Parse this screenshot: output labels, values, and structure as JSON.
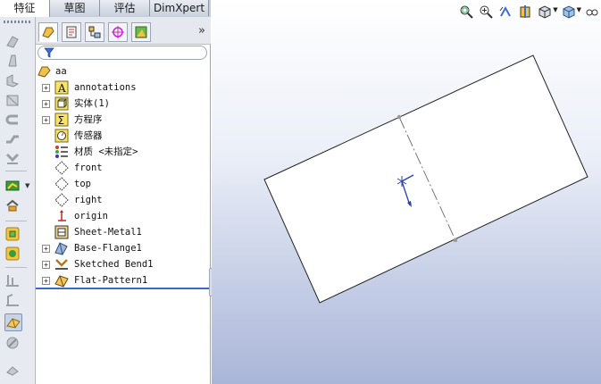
{
  "command_tabs": [
    {
      "label": "特征",
      "active": true
    },
    {
      "label": "草图",
      "active": false
    },
    {
      "label": "评估",
      "active": false
    },
    {
      "label": "DimXpert",
      "active": false
    }
  ],
  "left_toolbar": {
    "icons": [
      "sheet-metal-base-flange-icon",
      "tab-icon",
      "edge-flange-icon",
      "miter-flange-icon",
      "hem-icon",
      "jog-icon",
      "sketched-bend-icon",
      "insert-bends-icon",
      "convert-to-sheet-metal-icon",
      "lofted-bend-icon",
      "closed-corner-icon",
      "unfold-icon",
      "fold-icon",
      "flatten-icon",
      "no-bends-icon",
      "rip-icon"
    ],
    "selected": "flatten-icon"
  },
  "feature_manager": {
    "tab_icons": [
      "featuremanager-tree-icon",
      "propertymanager-icon",
      "configurationmanager-icon",
      "dimxpertmanager-icon",
      "displaymanager-icon"
    ],
    "filter_placeholder": "",
    "root": {
      "label": "aa",
      "icon": "part-icon"
    },
    "items": [
      {
        "label": "annotations",
        "icon": "annotations-icon",
        "expandable": true
      },
      {
        "label": "实体(1)",
        "icon": "solid-bodies-icon",
        "expandable": true
      },
      {
        "label": "方程序",
        "icon": "equations-icon",
        "expandable": true
      },
      {
        "label": "传感器",
        "icon": "sensors-icon",
        "expandable": false
      },
      {
        "label": "材质 <未指定>",
        "icon": "material-icon",
        "expandable": false
      },
      {
        "label": "front",
        "icon": "plane-icon",
        "expandable": false
      },
      {
        "label": "top",
        "icon": "plane-icon",
        "expandable": false
      },
      {
        "label": "right",
        "icon": "plane-icon",
        "expandable": false
      },
      {
        "label": "origin",
        "icon": "origin-icon",
        "expandable": false
      },
      {
        "label": "Sheet-Metal1",
        "icon": "sheet-metal-icon",
        "expandable": false
      },
      {
        "label": "Base-Flange1",
        "icon": "base-flange-icon",
        "expandable": true
      },
      {
        "label": "Sketched Bend1",
        "icon": "sketched-bend-icon",
        "expandable": true
      },
      {
        "label": "Flat-Pattern1",
        "icon": "flat-pattern-icon",
        "expandable": true
      }
    ]
  },
  "view_toolbar": {
    "icons": [
      "zoom-to-fit-icon",
      "zoom-to-area-icon",
      "previous-view-icon",
      "section-view-icon",
      "view-orientation-icon",
      "display-style-icon",
      "hide-show-items-icon"
    ]
  },
  "colors": {
    "tree_separator": "#3a6ac5",
    "background_bottom": "#aab6d8",
    "sheet_edge": "#222222"
  }
}
